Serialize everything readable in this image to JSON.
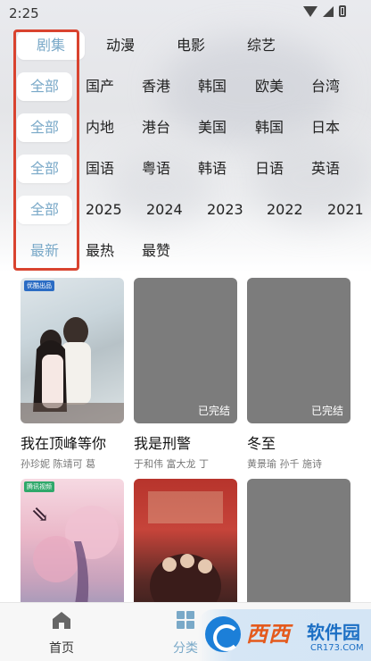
{
  "status": {
    "time": "2:25"
  },
  "filters": {
    "row1": [
      "剧集",
      "动漫",
      "电影",
      "综艺"
    ],
    "row2": [
      "全部",
      "国产",
      "香港",
      "韩国",
      "欧美",
      "台湾"
    ],
    "row3": [
      "全部",
      "内地",
      "港台",
      "美国",
      "韩国",
      "日本"
    ],
    "row4": [
      "全部",
      "国语",
      "粤语",
      "韩语",
      "日语",
      "英语"
    ],
    "row5": [
      "全部",
      "2025",
      "2024",
      "2023",
      "2022",
      "2021"
    ],
    "row6": [
      "最新",
      "最热",
      "最赞"
    ]
  },
  "cards": [
    {
      "title": "我在顶峰等你",
      "cast": "孙珍妮  陈靖可  葛",
      "badge": "",
      "tag": "优酷出品"
    },
    {
      "title": "我是刑警",
      "cast": "于和伟  富大龙  丁",
      "badge": "已完结"
    },
    {
      "title": "冬至",
      "cast": "黄景瑜  孙千  施诗",
      "badge": "已完结"
    },
    {
      "title": "",
      "cast": "",
      "badge": "",
      "tag": "腾讯视频"
    },
    {
      "title": "",
      "cast": "",
      "badge": ""
    },
    {
      "title": "",
      "cast": "",
      "badge": ""
    }
  ],
  "bottom_nav": {
    "home": "首页",
    "category": "分类"
  },
  "watermark": {
    "main": "西西",
    "brand": "软件园",
    "url": "CR173.COM"
  },
  "colors": {
    "accent": "#7aa9c8",
    "highlight": "#d9432f"
  }
}
